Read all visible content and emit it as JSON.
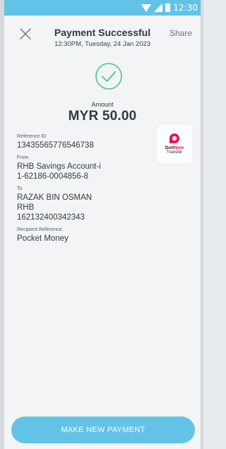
{
  "status_bar": {
    "time": "12:30"
  },
  "header": {
    "title": "Payment Successful",
    "subtitle": "12:30PM, Tuesday, 24 Jan 2023",
    "share_label": "Share"
  },
  "amount": {
    "label": "Amount",
    "value": "MYR 50.00"
  },
  "details": {
    "reference_id_label": "Reference ID",
    "reference_id": "13435565776546738",
    "from_label": "From",
    "from_account": "RHB Savings Account-i",
    "from_number": "1-62186-0004856-8",
    "to_label": "To",
    "to_name": "RAZAK BIN OSMAN",
    "to_bank": "RHB",
    "to_number": "162132400342343",
    "recipient_ref_label": "Recipient Reference",
    "recipient_ref": "Pocket Money"
  },
  "duitnow": {
    "duit": "Duit",
    "now": "Now",
    "transfer": "Transfer"
  },
  "footer": {
    "button_label": "MAKE NEW PAYMENT"
  },
  "colors": {
    "accent": "#63c3e6",
    "success": "#4fc48a",
    "brand_pink": "#e2145a",
    "text": "#2f3c48"
  },
  "icons": {
    "close": "close-icon",
    "success": "check-circle-icon",
    "duitnow": "duitnow-logo-icon"
  }
}
